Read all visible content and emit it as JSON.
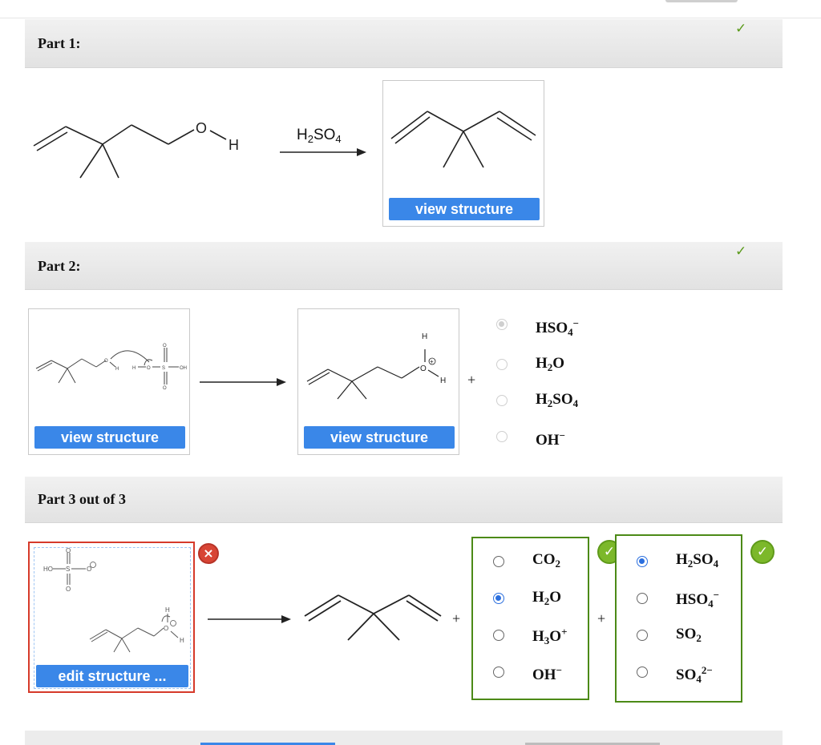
{
  "part1": {
    "title": "Part 1:",
    "status": "✓",
    "reagent": "H2SO4",
    "reactant_labels": {
      "oxygen": "O",
      "hydrogen": "H"
    },
    "product_button": "view structure"
  },
  "part2": {
    "title": "Part 2:",
    "status": "✓",
    "left_button": "view structure",
    "right_button": "view structure",
    "plus": "+",
    "options": [
      {
        "label": "HSO4−",
        "selected": true
      },
      {
        "label": "H2O",
        "selected": false
      },
      {
        "label": "H2SO4",
        "selected": false
      },
      {
        "label": "OH−",
        "selected": false
      }
    ]
  },
  "part3": {
    "title": "Part 3 out of 3",
    "edit_button": "edit structure ...",
    "error_icon": "×",
    "plus": "+",
    "group1": {
      "status": "✓",
      "options": [
        {
          "label": "CO2",
          "selected": false
        },
        {
          "label": "H2O",
          "selected": true
        },
        {
          "label": "H3O+",
          "selected": false
        },
        {
          "label": "OH−",
          "selected": false
        }
      ]
    },
    "group2": {
      "status": "✓",
      "options": [
        {
          "label": "H2SO4",
          "selected": true
        },
        {
          "label": "HSO4−",
          "selected": false
        },
        {
          "label": "SO2",
          "selected": false
        },
        {
          "label": "SO42−",
          "selected": false
        }
      ]
    }
  },
  "colors": {
    "accent_blue": "#3a87e8",
    "success_green": "#7cb82a",
    "error_red": "#d84535"
  }
}
